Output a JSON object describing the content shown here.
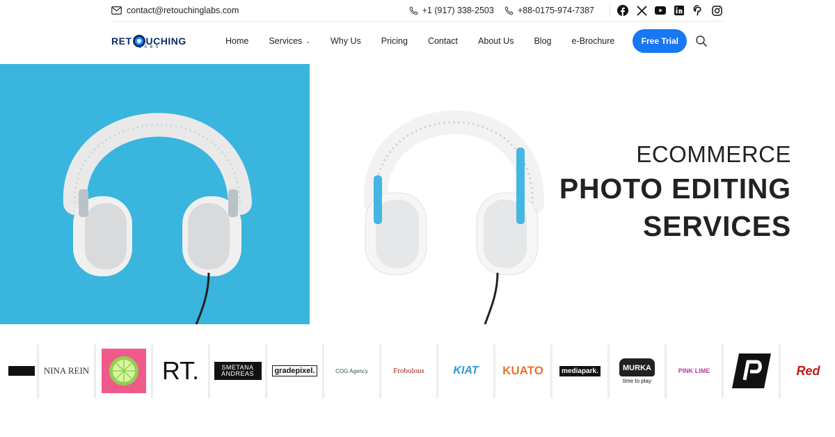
{
  "topbar": {
    "email": "contact@retouchinglabs.com",
    "phone1": "+1 (917) 338-2503",
    "phone2": "+88-0175-974-7387",
    "socials": [
      "facebook-icon",
      "x-icon",
      "youtube-icon",
      "linkedin-icon",
      "pinterest-icon",
      "instagram-icon"
    ]
  },
  "logo": {
    "word_left": "RET",
    "word_right": "UCHING",
    "sub": "LABS"
  },
  "nav": {
    "items": [
      "Home",
      "Services",
      "Why Us",
      "Pricing",
      "Contact",
      "About Us",
      "Blog",
      "e-Brochure"
    ],
    "cta": "Free Trial"
  },
  "hero": {
    "line1": "ECOMMERCE",
    "line2": "PHOTO EDITING",
    "line3": "SERVICES"
  },
  "clients": {
    "names": [
      "NINA REIN",
      "RT.",
      "SMETANA ANDREAS",
      "gradepixel.",
      "COG Agency",
      "Frobolous",
      "KIAT",
      "KUATO",
      "mediapark.",
      "MURKA",
      "time to play",
      "PINK LIME",
      "Red"
    ]
  },
  "colors": {
    "accent": "#1877f2",
    "hero_blue": "#3ab5de",
    "navy": "#0c2d6b"
  }
}
